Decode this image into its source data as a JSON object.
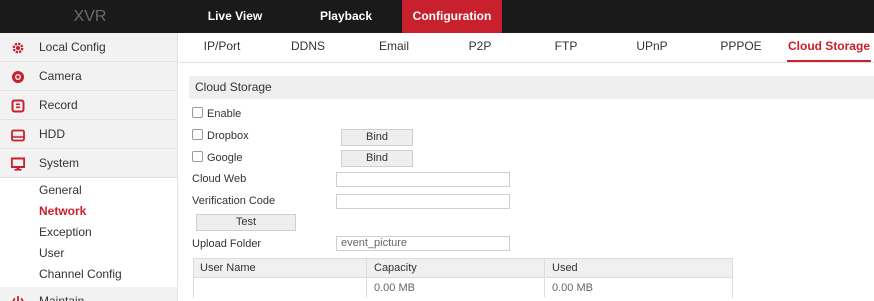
{
  "brand": "XVR",
  "nav": {
    "tabs": [
      {
        "label": "Live View"
      },
      {
        "label": "Playback"
      },
      {
        "label": "Configuration"
      }
    ],
    "active": "Configuration"
  },
  "sidebar": {
    "items": [
      {
        "label": "Local Config",
        "icon": "gear-icon"
      },
      {
        "label": "Camera",
        "icon": "camera-icon"
      },
      {
        "label": "Record",
        "icon": "record-icon"
      },
      {
        "label": "HDD",
        "icon": "hdd-icon"
      },
      {
        "label": "System",
        "icon": "monitor-icon"
      },
      {
        "label": "Maintain",
        "icon": "power-icon"
      }
    ],
    "system_sub": [
      {
        "label": "General"
      },
      {
        "label": "Network"
      },
      {
        "label": "Exception"
      },
      {
        "label": "User"
      },
      {
        "label": "Channel Config"
      }
    ],
    "active_sub": "Network"
  },
  "subtabs": {
    "items": [
      {
        "label": "IP/Port"
      },
      {
        "label": "DDNS"
      },
      {
        "label": "Email"
      },
      {
        "label": "P2P"
      },
      {
        "label": "FTP"
      },
      {
        "label": "UPnP"
      },
      {
        "label": "PPPOE"
      },
      {
        "label": "Cloud Storage"
      }
    ],
    "active": "Cloud Storage"
  },
  "cloud": {
    "section_title": "Cloud Storage",
    "enable_label": "Enable",
    "dropbox_label": "Dropbox",
    "google_label": "Google",
    "bind_label": "Bind",
    "cloud_web_label": "Cloud Web",
    "cloud_web_value": "",
    "verification_label": "Verification Code",
    "verification_value": "",
    "test_label": "Test",
    "upload_folder_label": "Upload Folder",
    "upload_folder_value": "event_picture"
  },
  "storage_table": {
    "headers": [
      "User Name",
      "Capacity",
      "Used"
    ],
    "rows": [
      {
        "user_name": "",
        "capacity": "0.00 MB",
        "used": "0.00 MB"
      }
    ]
  },
  "colors": {
    "accent": "#c8202c",
    "topbar": "#1a1a1a",
    "sidebar_bg": "#f2f2f2"
  }
}
